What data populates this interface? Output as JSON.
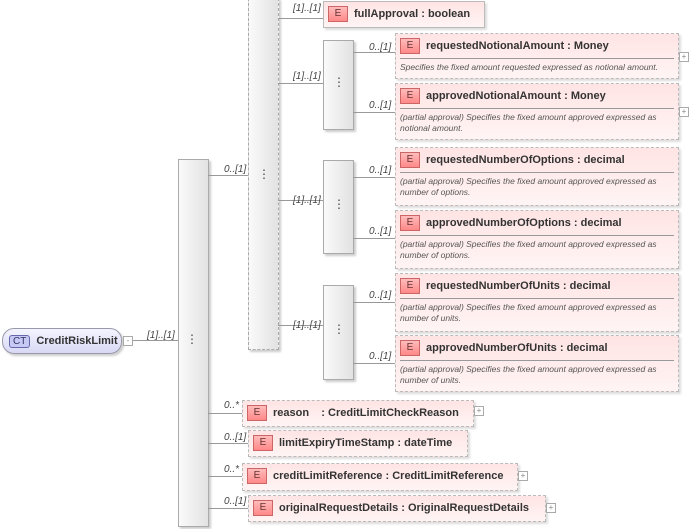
{
  "root": {
    "badge": "CT",
    "name": "CreditRiskLimit",
    "collapse": "-",
    "card": "[1]..[1]"
  },
  "choice": {
    "card": "0..[1]"
  },
  "branches": [
    {
      "card": "[1]..[1]"
    },
    {
      "card": "[1]..[1]"
    },
    {
      "card": "[1]..[1]"
    },
    {
      "card": "[1]..[1]"
    }
  ],
  "elements": [
    {
      "badge": "E",
      "name": "fullApproval",
      "type": "boolean"
    },
    {
      "badge": "E",
      "name": "requestedNotionalAmount",
      "type": "Money",
      "card": "0..[1]",
      "desc": "Specifies the fixed amount requested expressed as notional amount."
    },
    {
      "badge": "E",
      "name": "approvedNotionalAmount",
      "type": "Money",
      "card": "0..[1]",
      "desc": "(partial approval) Specifies the fixed amount approved expressed as notional amount."
    },
    {
      "badge": "E",
      "name": "requestedNumberOfOptions",
      "type": "decimal",
      "card": "0..[1]",
      "desc": "(partial approval) Specifies the fixed amount approved expressed as number of options."
    },
    {
      "badge": "E",
      "name": "approvedNumberOfOptions",
      "type": "decimal",
      "card": "0..[1]",
      "desc": "(partial approval) Specifies the fixed amount approved expressed as number of options."
    },
    {
      "badge": "E",
      "name": "requestedNumberOfUnits",
      "type": "decimal",
      "card": "0..[1]",
      "desc": "(partial approval) Specifies the fixed amount approved expressed as number of units."
    },
    {
      "badge": "E",
      "name": "approvedNumberOfUnits",
      "type": "decimal",
      "card": "0..[1]",
      "desc": "(partial approval) Specifies the fixed amount approved expressed as number of units."
    },
    {
      "badge": "E",
      "name": "reason",
      "type": "CreditLimitCheckReason",
      "card": "0..*"
    },
    {
      "badge": "E",
      "name": "limitExpiryTimeStamp",
      "type": "dateTime",
      "card": "0..[1]"
    },
    {
      "badge": "E",
      "name": "creditLimitReference",
      "type": "CreditLimitReference",
      "card": "0..*"
    },
    {
      "badge": "E",
      "name": "originalRequestDetails",
      "type": "OriginalRequestDetails",
      "card": "0..[1]"
    }
  ],
  "expand": "+",
  "sep": " : "
}
